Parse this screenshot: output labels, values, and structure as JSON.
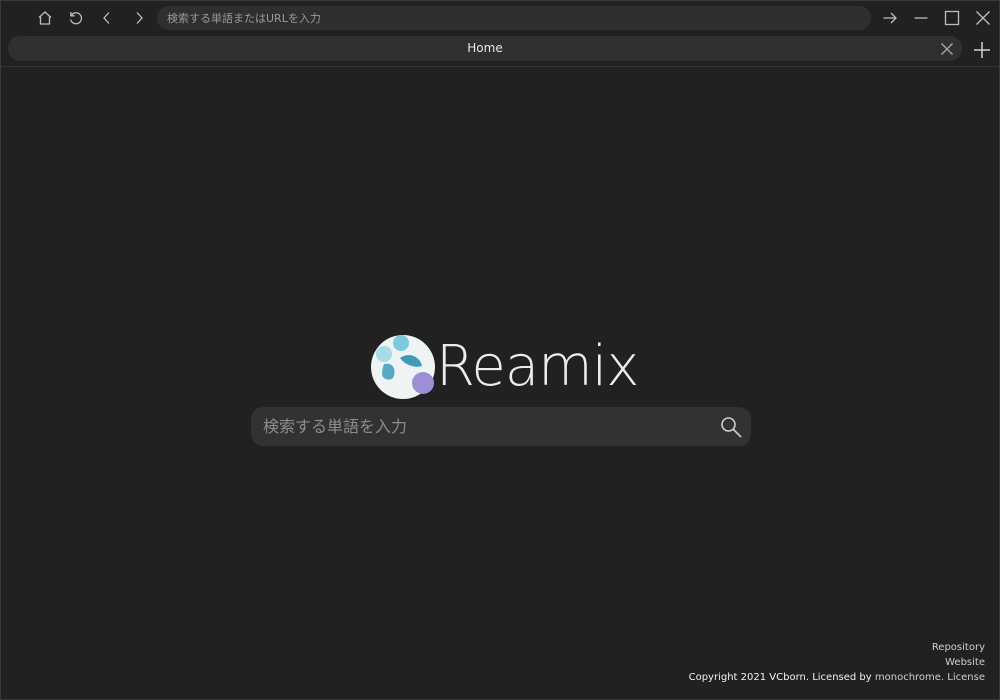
{
  "toolbar": {
    "home_icon": "home-icon",
    "reload_icon": "reload-icon",
    "back_icon": "chevron-left-icon",
    "forward_icon": "chevron-right-icon",
    "url_placeholder": "検索する単語またはURLを入力",
    "go_icon": "arrow-right-icon",
    "minimize_icon": "minimize-icon",
    "maximize_icon": "maximize-icon",
    "close_icon": "close-icon"
  },
  "tabs": [
    {
      "title": "Home",
      "close_icon": "close-icon"
    }
  ],
  "new_tab_icon": "plus-icon",
  "main": {
    "logo_text": "Reamix",
    "search_placeholder": "検索する単語を入力",
    "search_icon": "search-icon"
  },
  "footer": {
    "repository": "Repository",
    "website": "Website",
    "copyright_prefix": "Copyright 2021 VCborn. Licensed by ",
    "license_holder": "monochrome.",
    "license": "License"
  },
  "colors": {
    "background": "#212121",
    "bar": "#2f2f2f",
    "text": "#d8d8d8",
    "logo_teal": "#5ab3c9",
    "logo_purple": "#9c8fd6"
  }
}
